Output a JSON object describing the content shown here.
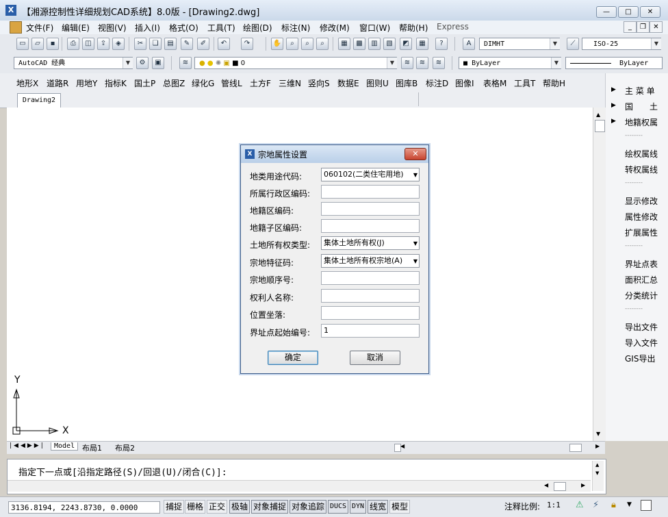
{
  "window": {
    "title": "【湘源控制性详细规划CAD系统】8.0版 - [Drawing2.dwg]",
    "app_icon": "app-logo-icon",
    "min_glyph": "—",
    "max_glyph": "□",
    "close_glyph": "✕"
  },
  "menubar": {
    "items": [
      "文件(F)",
      "编辑(E)",
      "视图(V)",
      "插入(I)",
      "格式(O)",
      "工具(T)",
      "绘图(D)",
      "标注(N)",
      "修改(M)",
      "窗口(W)",
      "帮助(H)",
      "Express"
    ]
  },
  "toolbars": {
    "dimstyle": "DIMHT",
    "textstyle": "ISO-25",
    "workspace": "AutoCAD 经典",
    "layer": "0",
    "color": "ByLayer",
    "linetype": "ByLayer"
  },
  "custom_menu": {
    "items": [
      "地形X",
      "道路R",
      "用地Y",
      "指标K",
      "国土P",
      "总图Z",
      "绿化G",
      "管线L",
      "土方F",
      "三维N",
      "竖向S",
      "数据E",
      "图则U",
      "图库B",
      "标注D",
      "图像I",
      "表格M",
      "工具T",
      "帮助H"
    ]
  },
  "right_panel": {
    "group1": [
      "主 菜 单",
      "国　　土",
      "地籍权属"
    ],
    "sep": "--------",
    "group2": [
      "绘权属线",
      "转权属线"
    ],
    "group3": [
      "显示修改",
      "属性修改",
      "扩展属性"
    ],
    "group4": [
      "界址点表",
      "面积汇总",
      "分类统计"
    ],
    "group5": [
      "导出文件",
      "导入文件",
      "GIS导出"
    ]
  },
  "document": {
    "tab": "Drawing2"
  },
  "ucs": {
    "x_label": "X",
    "y_label": "Y"
  },
  "layout_tabs": [
    "Model",
    "布局1",
    "布局2"
  ],
  "dialog": {
    "title": "宗地属性设置",
    "fields": [
      {
        "label": "地类用途代码:",
        "value": "060102(二类住宅用地)",
        "type": "select"
      },
      {
        "label": "所属行政区编码:",
        "value": "",
        "type": "text"
      },
      {
        "label": "地籍区编码:",
        "value": "",
        "type": "text"
      },
      {
        "label": "地籍子区编码:",
        "value": "",
        "type": "text"
      },
      {
        "label": "土地所有权类型:",
        "value": "集体土地所有权(J)",
        "type": "select"
      },
      {
        "label": "宗地特征码:",
        "value": "集体土地所有权宗地(A)",
        "type": "select"
      },
      {
        "label": "宗地顺序号:",
        "value": "",
        "type": "text"
      },
      {
        "label": "权利人名称:",
        "value": "",
        "type": "text"
      },
      {
        "label": "位置坐落:",
        "value": "",
        "type": "text"
      },
      {
        "label": "界址点起始编号:",
        "value": "1",
        "type": "text"
      }
    ],
    "ok_label": "确定",
    "cancel_label": "取消"
  },
  "command": {
    "prompt": "指定下一点或[沿指定路径(S)/回退(U)/闭合(C)]:"
  },
  "status": {
    "coords": "3136.8194, 2243.8730, 0.0000",
    "buttons": [
      "捕捉",
      "栅格",
      "正交",
      "极轴",
      "对象捕捉",
      "对象追踪",
      "DUCS",
      "DYN",
      "线宽",
      "模型"
    ],
    "on_buttons": [
      "极轴",
      "对象捕捉",
      "对象追踪",
      "DUCS",
      "DYN",
      "线宽"
    ],
    "scale_label": "注释比例:",
    "scale_value": "1:1"
  }
}
